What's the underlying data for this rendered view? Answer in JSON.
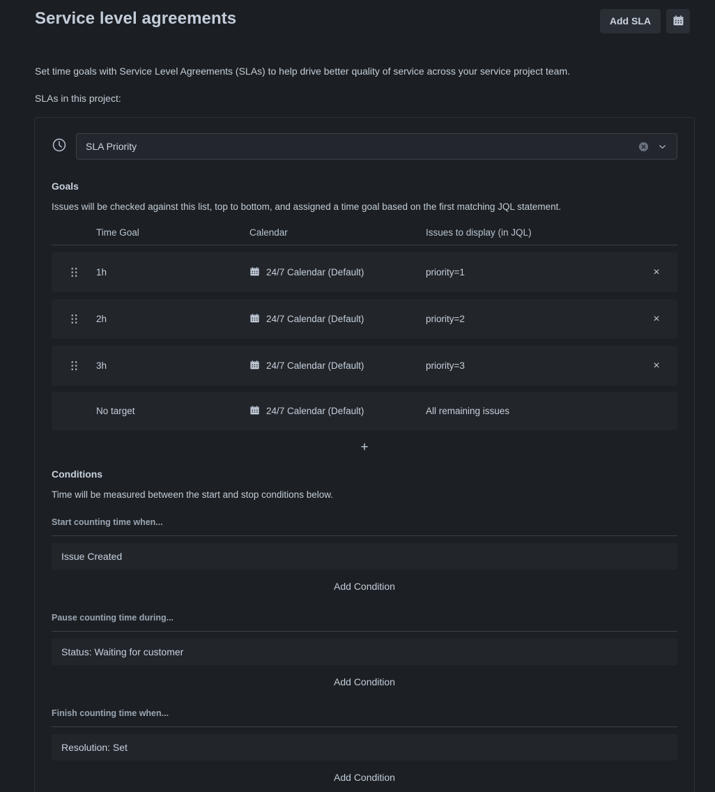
{
  "header": {
    "title": "Service level agreements",
    "add_sla_label": "Add SLA",
    "calendar_button_icon": "calendar-icon"
  },
  "intro": {
    "description": "Set time goals with Service Level Agreements (SLAs) to help drive better quality of service across your service project team.",
    "list_label": "SLAs in this project:"
  },
  "sla_select": {
    "icon": "clock-icon",
    "value": "SLA Priority",
    "clear_icon": "clear-circle-icon",
    "chevron_icon": "chevron-down-icon"
  },
  "goals": {
    "title": "Goals",
    "description": "Issues will be checked against this list, top to bottom, and assigned a time goal based on the first matching JQL statement.",
    "columns": [
      "Time Goal",
      "Calendar",
      "Issues to display (in JQL)"
    ],
    "rows": [
      {
        "time_goal": "1h",
        "calendar": "24/7 Calendar (Default)",
        "jql": "priority=1",
        "draggable": true,
        "deletable": true,
        "delete_label": "×"
      },
      {
        "time_goal": "2h",
        "calendar": "24/7 Calendar (Default)",
        "jql": "priority=2",
        "draggable": true,
        "deletable": true,
        "delete_label": "×"
      },
      {
        "time_goal": "3h",
        "calendar": "24/7 Calendar (Default)",
        "jql": "priority=3",
        "draggable": true,
        "deletable": true,
        "delete_label": "×"
      },
      {
        "time_goal": "No target",
        "calendar": "24/7 Calendar (Default)",
        "jql": "All remaining issues",
        "draggable": false,
        "deletable": false,
        "delete_label": ""
      }
    ],
    "add_goal_label": "+"
  },
  "conditions": {
    "title": "Conditions",
    "description": "Time will be measured between the start and stop conditions below.",
    "groups": [
      {
        "label": "Start counting time when...",
        "items": [
          "Issue Created"
        ],
        "add_label": "Add Condition"
      },
      {
        "label": "Pause counting time during...",
        "items": [
          "Status: Waiting for customer"
        ],
        "add_label": "Add Condition"
      },
      {
        "label": "Finish counting time when...",
        "items": [
          "Resolution: Set"
        ],
        "add_label": "Add Condition"
      }
    ]
  },
  "colors": {
    "page_background": "#1b1f23",
    "panel_background": "#1c2024",
    "row_background": "#22262b",
    "text_primary": "#c7d0db",
    "text_muted": "#9aa4b1",
    "divider": "#3b424b"
  }
}
